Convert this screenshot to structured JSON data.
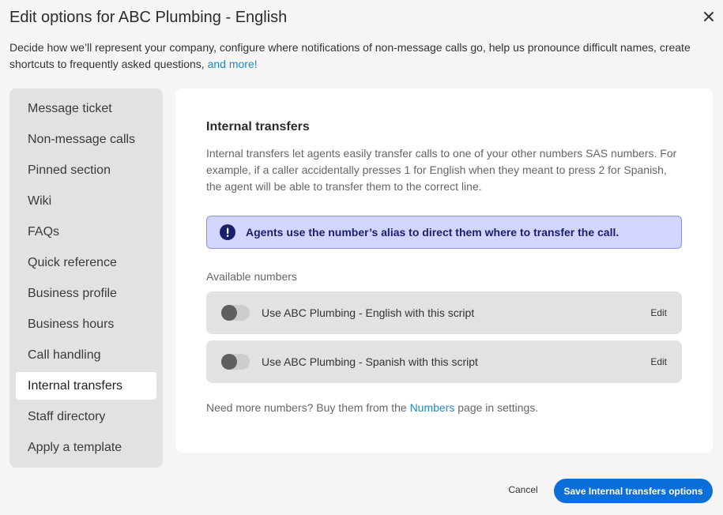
{
  "dialog": {
    "title": "Edit options for ABC Plumbing - English",
    "intro_text": "Decide how we’ll represent your company, configure where notifications of non-message calls go, help us pronounce difficult names, create shortcuts to frequently asked questions, ",
    "intro_link": "and more!"
  },
  "sidebar": {
    "items": [
      {
        "label": "Message ticket"
      },
      {
        "label": "Non-message calls"
      },
      {
        "label": "Pinned section"
      },
      {
        "label": "Wiki"
      },
      {
        "label": "FAQs"
      },
      {
        "label": "Quick reference"
      },
      {
        "label": "Business profile"
      },
      {
        "label": "Business hours"
      },
      {
        "label": "Call handling"
      },
      {
        "label": "Internal transfers"
      },
      {
        "label": "Staff directory"
      },
      {
        "label": "Apply a template"
      }
    ],
    "active": "Internal transfers"
  },
  "panel": {
    "title": "Internal transfers",
    "description": "Internal transfers let agents easily transfer calls to one of your other numbers SAS numbers. For example, if a caller accidentally presses 1 for English when they meant to press 2 for Spanish, the agent will be able to transfer them to the correct line.",
    "banner": "Agents use the number’s alias to direct them where to transfer the call.",
    "available_label": "Available numbers",
    "numbers": [
      {
        "label": "Use ABC Plumbing - English with this script",
        "edit": "Edit",
        "enabled": false
      },
      {
        "label": "Use ABC Plumbing - Spanish with this script",
        "edit": "Edit",
        "enabled": false
      }
    ],
    "footnote_pre": "Need more numbers? Buy them from the ",
    "footnote_link": "Numbers",
    "footnote_post": " page in settings."
  },
  "footer": {
    "cancel_label": "Cancel",
    "save_label": "Save Internal transfers options"
  },
  "colors": {
    "accent": "#0a6fd8",
    "link": "#1e88c8",
    "banner_bg": "#d2d6ff",
    "banner_text": "#1a1f6b"
  },
  "icons": {
    "close": "close-icon",
    "info": "exclamation-icon"
  }
}
